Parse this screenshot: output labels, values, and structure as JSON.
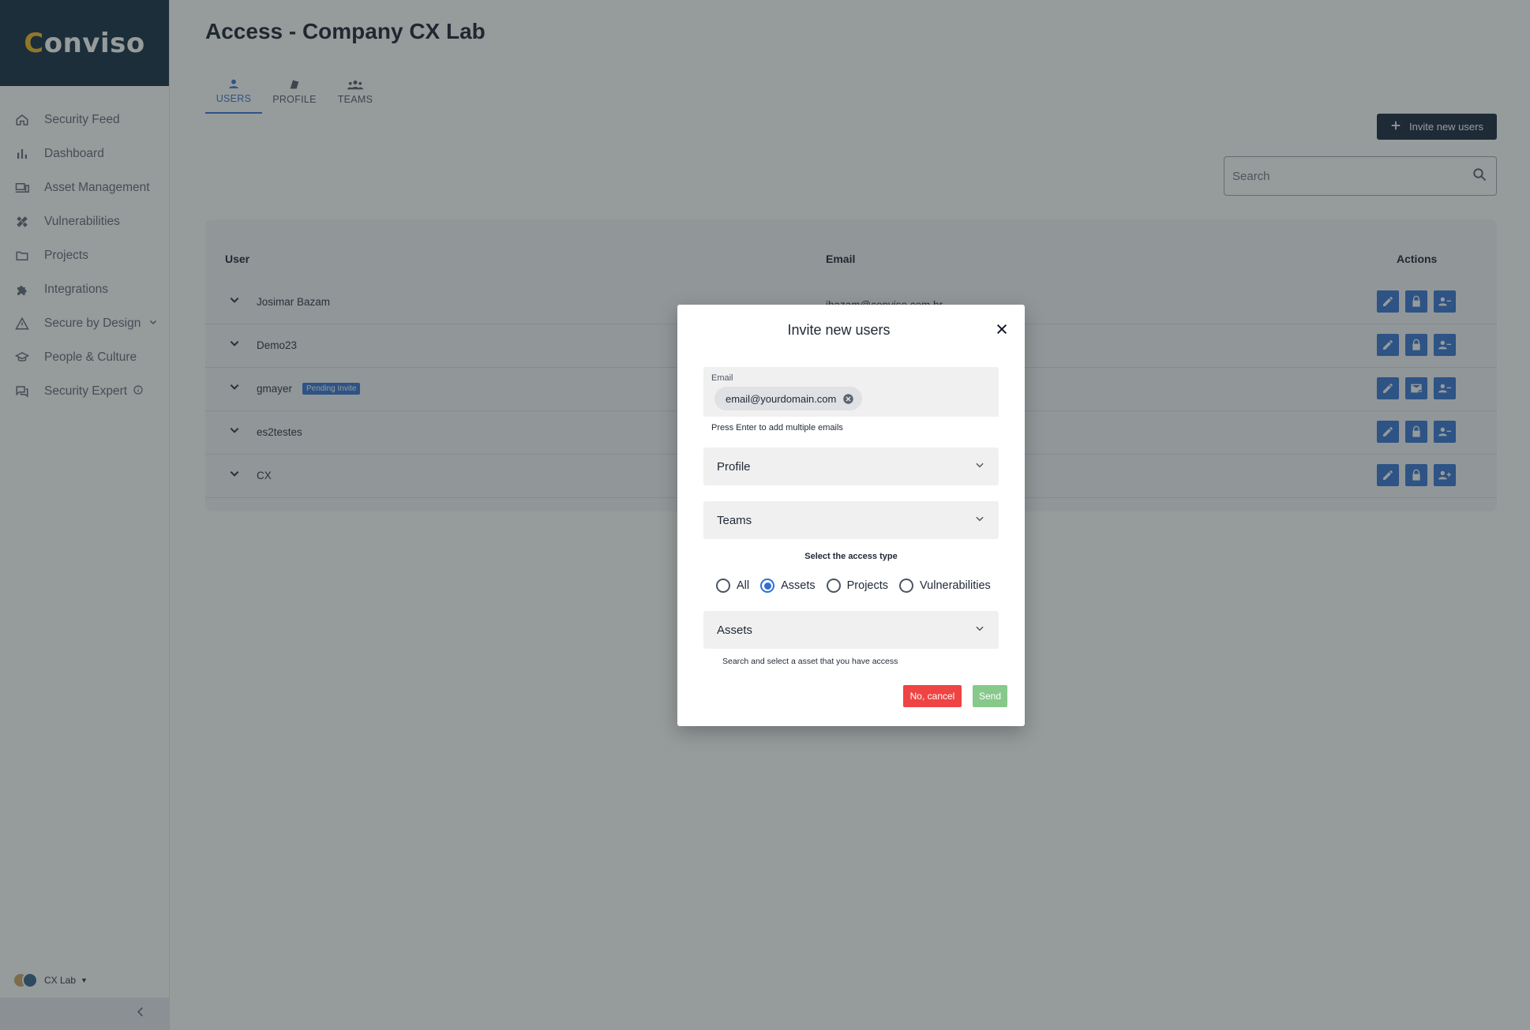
{
  "brand": {
    "name": "Conviso",
    "rest": "onviso"
  },
  "sidebar": {
    "items": [
      {
        "label": "Security Feed",
        "icon": "home-icon"
      },
      {
        "label": "Dashboard",
        "icon": "bar-chart-icon"
      },
      {
        "label": "Asset Management",
        "icon": "devices-icon"
      },
      {
        "label": "Vulnerabilities",
        "icon": "bandage-icon"
      },
      {
        "label": "Projects",
        "icon": "folder-icon"
      },
      {
        "label": "Integrations",
        "icon": "puzzle-icon"
      },
      {
        "label": "Secure by Design",
        "icon": "warning-icon"
      },
      {
        "label": "People & Culture",
        "icon": "graduation-cap-icon"
      },
      {
        "label": "Security Expert",
        "icon": "chat-icon"
      }
    ],
    "org": {
      "name": "CX Lab"
    }
  },
  "page": {
    "title": "Access - Company CX Lab"
  },
  "tabs": [
    {
      "label": "USERS",
      "active": true
    },
    {
      "label": "PROFILE",
      "active": false
    },
    {
      "label": "TEAMS",
      "active": false
    }
  ],
  "toolbar": {
    "invite_label": "Invite new users",
    "search_placeholder": "Search"
  },
  "table": {
    "columns": {
      "user": "User",
      "email": "Email",
      "actions": "Actions"
    },
    "rows": [
      {
        "name": "Josimar Bazam",
        "email": "jbazam@conviso.com.br",
        "badge": ""
      },
      {
        "name": "Demo23",
        "email": "",
        "badge": ""
      },
      {
        "name": "gmayer",
        "email": "",
        "badge": "Pending Invite"
      },
      {
        "name": "es2testes",
        "email": "",
        "badge": ""
      },
      {
        "name": "CX",
        "email": "",
        "badge": ""
      }
    ]
  },
  "modal": {
    "title": "Invite new users",
    "email_label": "Email",
    "email_chip": "email@yourdomain.com",
    "email_helper": "Press Enter to add multiple emails",
    "profile_label": "Profile",
    "teams_label": "Teams",
    "access_type_label": "Select the access type",
    "access_options": [
      "All",
      "Assets",
      "Projects",
      "Vulnerabilities"
    ],
    "access_selected": "Assets",
    "assets_label": "Assets",
    "assets_helper": "Search and select a asset that you have access",
    "cancel_label": "No, cancel",
    "send_label": "Send"
  },
  "colors": {
    "accent": "#2f6fd1",
    "brand_bg": "#0b2538",
    "brand_mark": "#f5b41a",
    "danger": "#ef4444",
    "send": "#86c98a"
  }
}
